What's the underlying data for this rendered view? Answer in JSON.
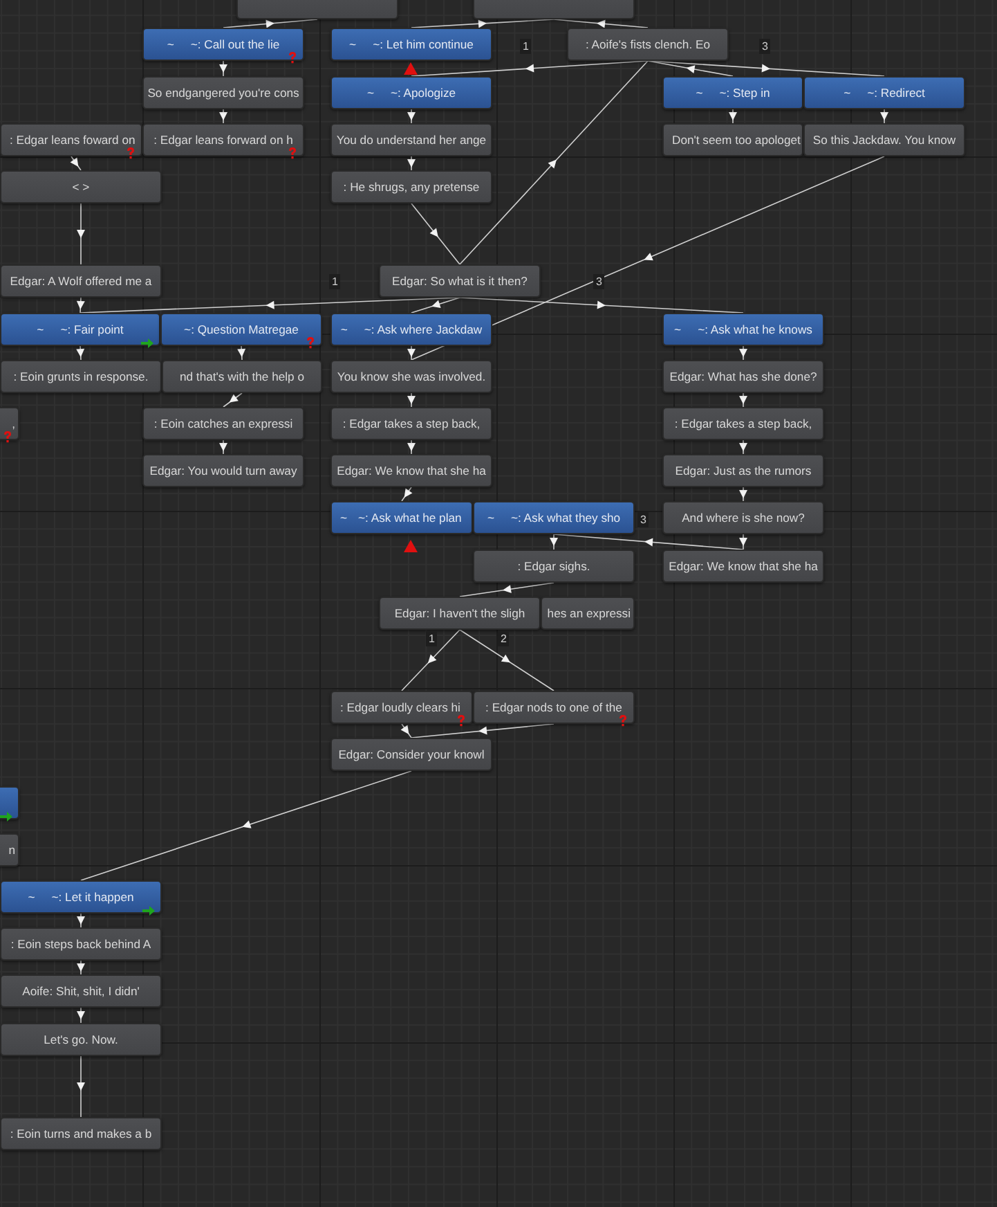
{
  "graph": {
    "nodes": [
      {
        "kind": "line"
      },
      {
        "kind": "line"
      },
      {
        "kind": "choice",
        "prefix": "~",
        "text": "~: Call out the lie",
        "question_mark": true
      },
      {
        "kind": "choice",
        "prefix": "~",
        "text": "~: Let him continue"
      },
      {
        "kind": "line",
        "text": ": Aoife's fists clench. Eo"
      },
      {
        "kind": "line",
        "text": "So endgangered you're cons"
      },
      {
        "kind": "choice",
        "prefix": "~",
        "text": "~: Apologize",
        "warning_above": true
      },
      {
        "kind": "choice",
        "prefix": "~",
        "text": "~: Step in"
      },
      {
        "kind": "choice",
        "prefix": "~",
        "text": "~: Redirect"
      },
      {
        "kind": "line",
        "text": ": Edgar leans foward on",
        "question_mark": true
      },
      {
        "kind": "line",
        "text": ": Edgar leans forward on h",
        "question_mark": true
      },
      {
        "kind": "line",
        "text": "You do understand her ange"
      },
      {
        "kind": "line",
        "text": "Don't seem too apologet"
      },
      {
        "kind": "line",
        "text": "So this Jackdaw. You know"
      },
      {
        "kind": "line",
        "text": "< >"
      },
      {
        "kind": "line",
        "text": ": He shrugs, any pretense"
      },
      {
        "kind": "line",
        "text": "Edgar: A Wolf offered me a"
      },
      {
        "kind": "line",
        "text": "Edgar: So what is it then?"
      },
      {
        "kind": "choice",
        "prefix": "~",
        "text": "~: Fair point",
        "exit_arrow": true
      },
      {
        "kind": "choice",
        "text": "~: Question Matregae",
        "question_mark": true
      },
      {
        "kind": "choice",
        "prefix": "~",
        "text": "~: Ask where Jackdaw"
      },
      {
        "kind": "choice",
        "prefix": "~",
        "text": "~: Ask what he knows"
      },
      {
        "kind": "line",
        "text": ": Eoin grunts in response."
      },
      {
        "kind": "line",
        "text": "nd that's with the help o"
      },
      {
        "kind": "line",
        "text": "You know she was involved."
      },
      {
        "kind": "line",
        "text": "Edgar: What has she done?"
      },
      {
        "kind": "line",
        "text": ",",
        "question_mark": true
      },
      {
        "kind": "line",
        "text": ": Eoin catches an expressi"
      },
      {
        "kind": "line",
        "text": ": Edgar takes a step back,"
      },
      {
        "kind": "line",
        "text": ": Edgar takes a step back,"
      },
      {
        "kind": "line",
        "text": "Edgar: You would turn away"
      },
      {
        "kind": "line",
        "text": "Edgar: We know that she ha"
      },
      {
        "kind": "line",
        "text": "Edgar: Just as the rumors"
      },
      {
        "kind": "choice",
        "prefix": "~",
        "text": "~: Ask what he plan",
        "warning_below": true
      },
      {
        "kind": "choice",
        "prefix": "~",
        "text": "~: Ask what they sho"
      },
      {
        "kind": "line",
        "text": "And where is she now?"
      },
      {
        "kind": "line",
        "text": ": Edgar sighs."
      },
      {
        "kind": "line",
        "text": "Edgar: We know that she ha"
      },
      {
        "kind": "line",
        "text": "Edgar: I haven't the sligh"
      },
      {
        "kind": "line",
        "text": "hes an expressi"
      },
      {
        "kind": "line",
        "text": ": Edgar loudly clears hi",
        "question_mark": true
      },
      {
        "kind": "line",
        "text": ": Edgar nods to one of the",
        "question_mark": true
      },
      {
        "kind": "line",
        "text": "Edgar: Consider your knowl"
      },
      {
        "kind": "choice",
        "exit_arrow": true
      },
      {
        "kind": "line",
        "text": "n"
      },
      {
        "kind": "choice",
        "prefix": "~",
        "text": "~: Let it happen",
        "exit_arrow": true
      },
      {
        "kind": "line",
        "text": ": Eoin steps back behind A"
      },
      {
        "kind": "line",
        "text": "Aoife: Shit, shit, I didn'"
      },
      {
        "kind": "line",
        "text": "Let's go. Now."
      },
      {
        "kind": "line",
        "text": ": Eoin turns and makes a b"
      }
    ],
    "edge_labels": [
      "1",
      "3",
      "1",
      "3",
      "3",
      "1",
      "2"
    ]
  }
}
